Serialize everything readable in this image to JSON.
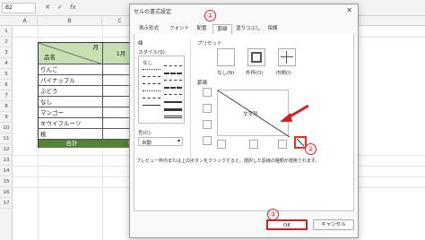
{
  "formula_bar": {
    "name_box": "B2",
    "cancel_glyph": "✕",
    "enter_glyph": "✓",
    "fx_label": "fx"
  },
  "sheet": {
    "columns": [
      "A",
      "B",
      "C"
    ],
    "rows": [
      "1",
      "2",
      "3",
      "4",
      "5",
      "6",
      "7",
      "8",
      "9",
      "10",
      "11",
      "12",
      "13",
      "14",
      "15",
      "16",
      "17"
    ],
    "table": {
      "header_month": "月",
      "header_item": "品名",
      "header_col_c": "1月",
      "items": [
        "りんご",
        "パイナップル",
        "ぶどう",
        "なし",
        "マンゴー",
        "キウイフルーツ",
        "桃"
      ],
      "item_values": [
        "¥",
        "¥",
        "¥",
        "¥",
        "¥",
        "¥",
        "¥"
      ],
      "total_label": "合計",
      "total_value": "¥2"
    }
  },
  "dialog": {
    "title": "セルの書式設定",
    "close_glyph": "✕",
    "tabs": [
      "表示形式",
      "フォント",
      "配置",
      "罫線",
      "塗りつぶし",
      "保護"
    ],
    "active_tab": "罫線",
    "line_section_label": "線",
    "style_label": "スタイル(S):",
    "none_label": "なし",
    "color_label": "色(C):",
    "color_value": "自動",
    "preset_section_label": "プリセット",
    "presets": [
      "なし(N)",
      "外枠(O)",
      "内側(I)"
    ],
    "border_section_label": "罫線",
    "preview_text": "文字列",
    "hint_text": "プレビュー枠内または上のボタンをクリックすると、選択した罫線の種類が適用されます。",
    "ok_label": "OK",
    "cancel_label": "キャンセル"
  },
  "annotations": {
    "step1": "①",
    "step2": "②",
    "step3": "③",
    "accent_color": "#d02020"
  }
}
